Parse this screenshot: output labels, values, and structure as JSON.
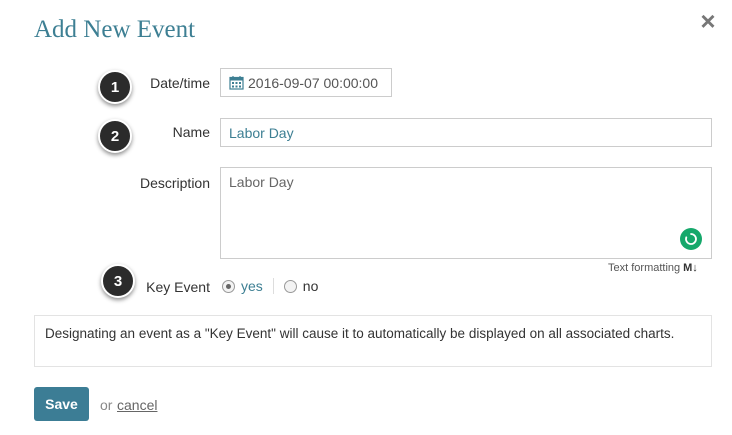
{
  "dialog": {
    "title": "Add New Event",
    "close_icon": "close-icon"
  },
  "markers": [
    "1",
    "2",
    "3"
  ],
  "form": {
    "datetime_label": "Date/time",
    "datetime_value": "2016-09-07 00:00:00",
    "calendar_icon": "calendar-icon",
    "name_label": "Name",
    "name_value": "Labor Day",
    "description_label": "Description",
    "description_value": "Labor Day",
    "grammar_icon": "grammar-check-icon",
    "text_formatting_label": "Text formatting",
    "markdown_icon": "M↓",
    "key_event_label": "Key Event",
    "key_event_options": [
      "yes",
      "no"
    ],
    "key_event_selected": "yes"
  },
  "info_text": "Designating an event as a \"Key Event\" will cause it to automatically be displayed on all associated charts.",
  "actions": {
    "save_label": "Save",
    "or_text": "or",
    "cancel_label": "cancel"
  },
  "colors": {
    "accent": "#3d7f93",
    "save_button": "#3c7d95",
    "marker": "#2b2b2b",
    "grammar": "#15a86b"
  }
}
